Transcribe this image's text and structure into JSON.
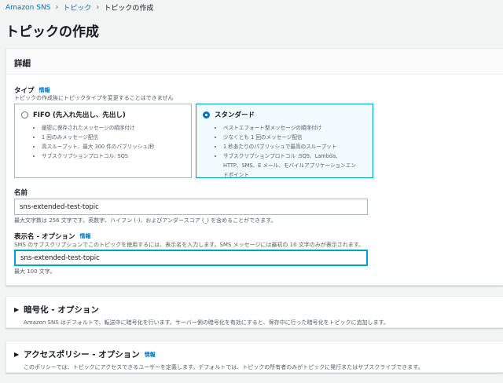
{
  "breadcrumb": {
    "items": [
      "Amazon SNS",
      "トピック"
    ],
    "current": "トピックの作成"
  },
  "page_title": "トピックの作成",
  "details": {
    "header": "詳細",
    "type": {
      "label": "タイプ",
      "info": "情報",
      "description": "トピックの作成後にトピックタイプを変更することはできません",
      "options": [
        {
          "title": "FIFO (先入れ先出し、先出し)",
          "selected": false,
          "bullets": [
            "厳密に保存されたメッセージの順序付け",
            "1 回のみメッセージ配信",
            "高スループット、最大 300 件のパブリッシュ/秒",
            "サブスクリプションプロトコル: SQS"
          ]
        },
        {
          "title": "スタンダード",
          "selected": true,
          "bullets": [
            "ベストエフォート型メッセージの順序付け",
            "少なくとも 1 回のメッセージ配信",
            "1 秒あたりのパブリッシュで最高のスループット",
            "サブスクリプションプロトコル :SQS、Lambda、",
            "HTTP、SMS、E メール、モバイルアプリケーションエン",
            "ドポイント"
          ]
        }
      ]
    },
    "name": {
      "label": "名前",
      "value": "sns-extended-test-topic",
      "hint": "最大文字数は 256 文字です。英数字、ハイフン (-)、およびアンダースコア (_) を含めることができます。"
    },
    "display_name": {
      "label": "表示名 - オプション",
      "info": "情報",
      "description": "SMS のサブスクリプションでこのトピックを使用するには、表示名を入力します。SMS メッセージには最初の 10 文字のみが表示されます。",
      "value": "sns-extended-test-topic",
      "hint": "最大 100 文字。"
    }
  },
  "encryption": {
    "title": "暗号化 - オプション",
    "description": "Amazon SNS はデフォルトで、転送中に暗号化を行います。サーバー側の暗号化を有効にすると、保存中に行った暗号化をトピックに追加します。"
  },
  "access_policy": {
    "title": "アクセスポリシー - オプション",
    "info": "情報",
    "description": "このポリシーでは、トピックにアクセスできるユーザーを定義します。デフォルトでは、トピックの所有者のみがトピックに発行またはサブスクライブできます。"
  }
}
